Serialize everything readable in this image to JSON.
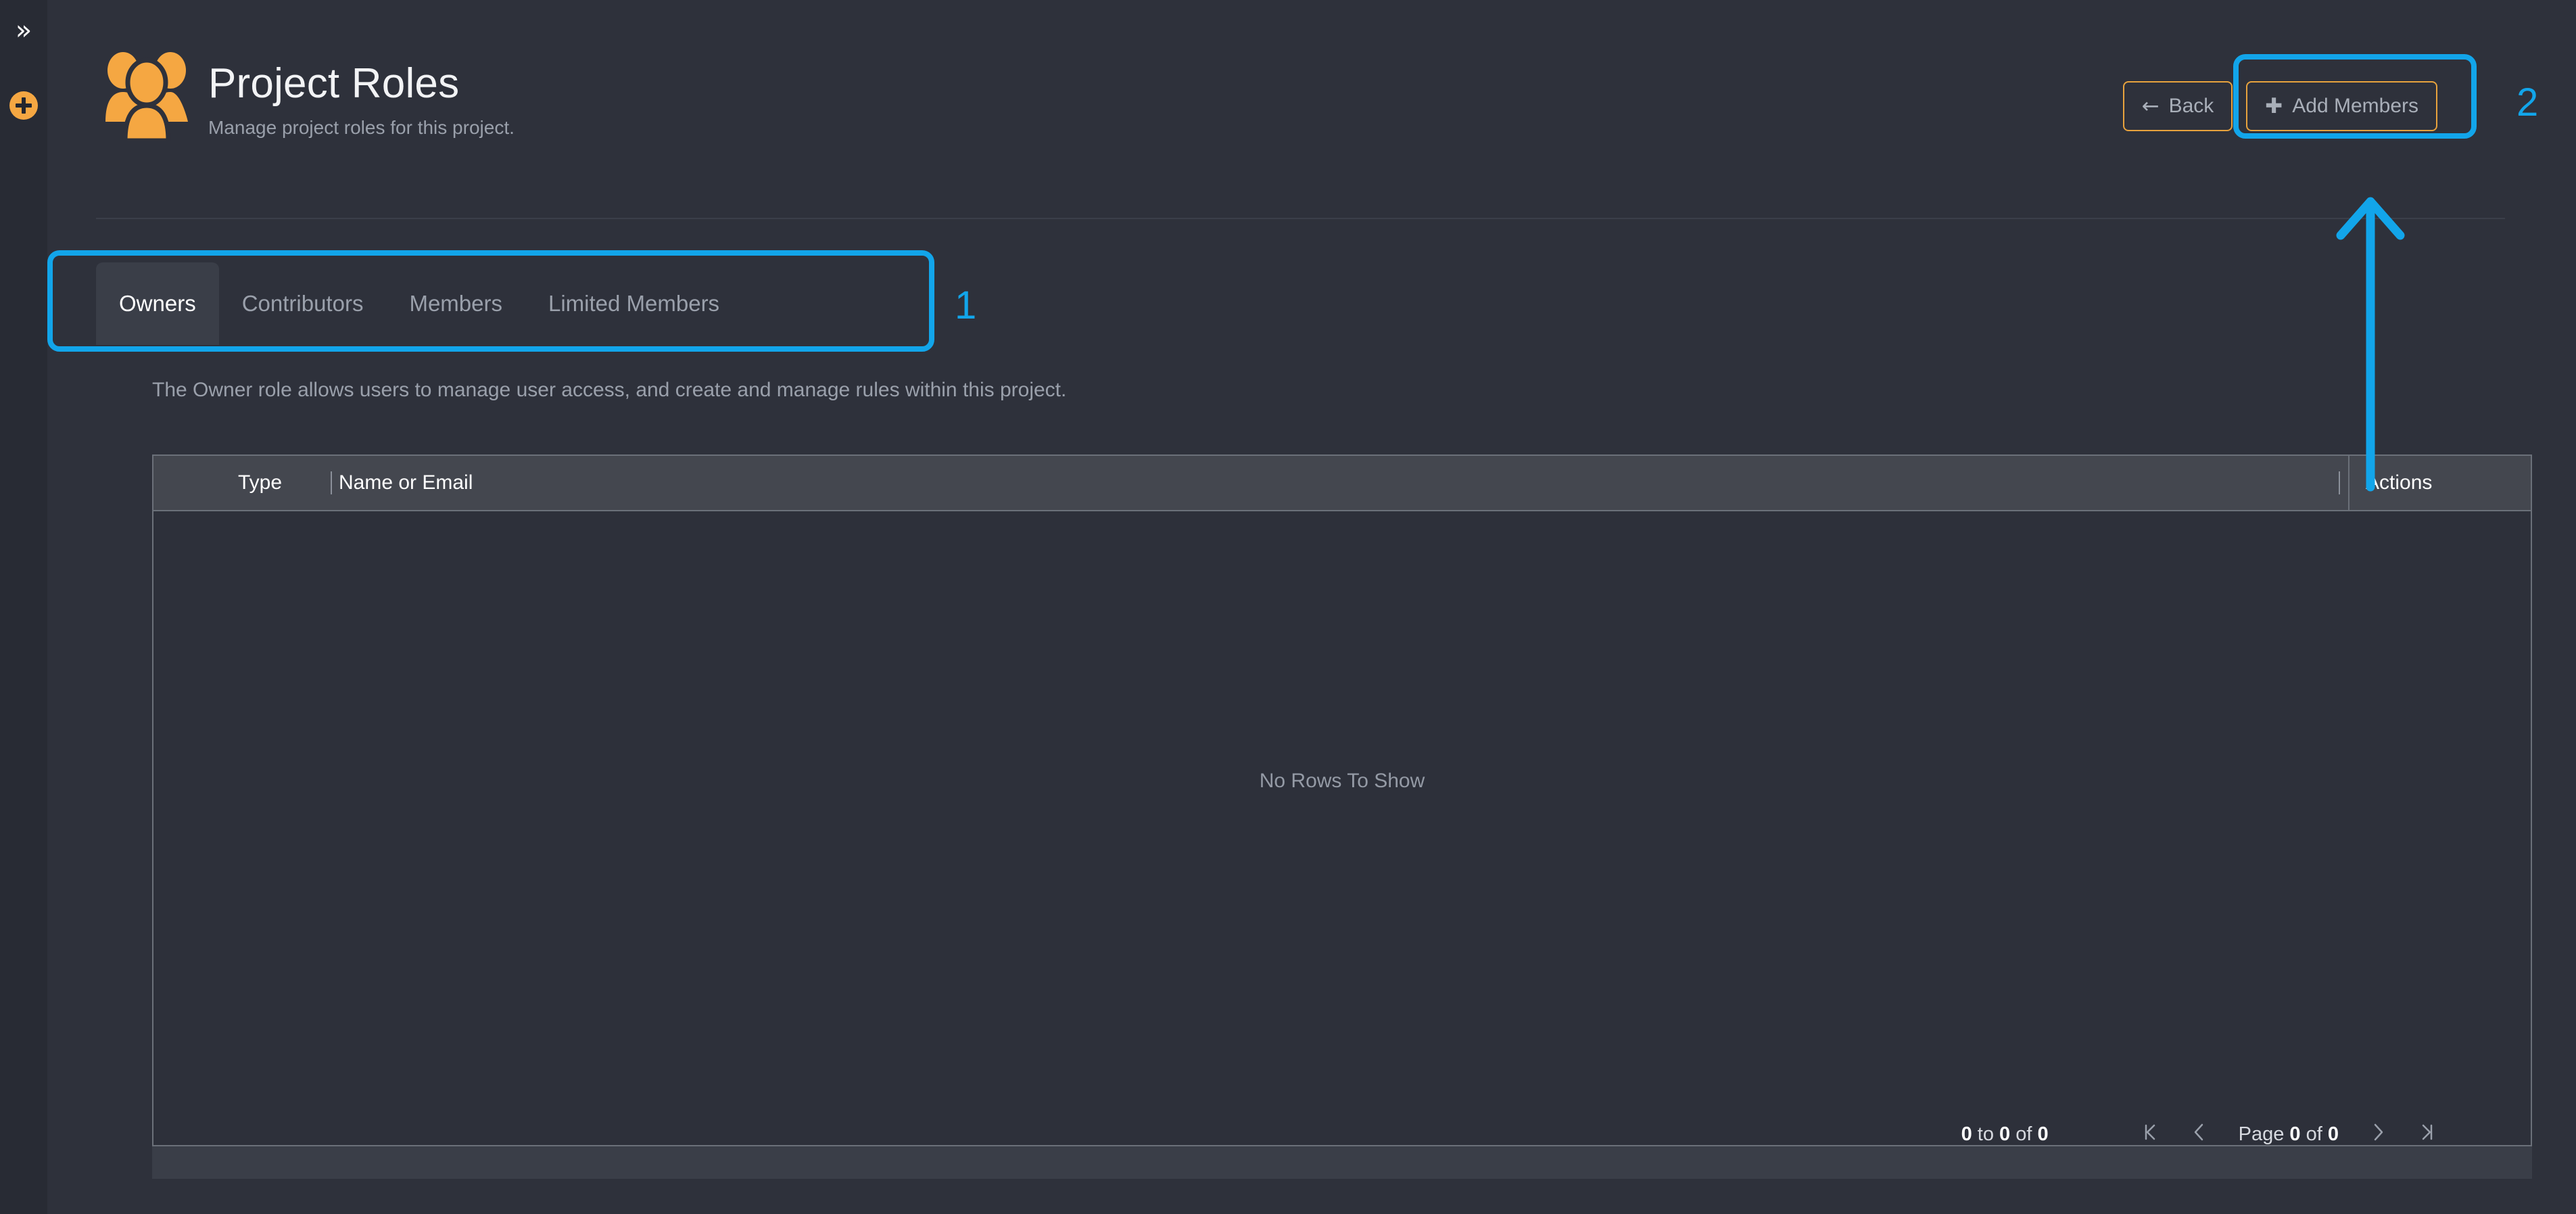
{
  "rail": {
    "expand_icon": "chevron-double-right-icon",
    "expand_glyph": "»",
    "add_icon": "plus-circle-icon"
  },
  "header": {
    "icon": "people-group-icon",
    "title": "Project Roles",
    "subtitle": "Manage project roles for this project.",
    "buttons": [
      {
        "id": "back",
        "label": "Back",
        "glyph": "←",
        "icon": "arrow-left-icon"
      },
      {
        "id": "add-members",
        "label": "Add Members",
        "glyph": "✚",
        "icon": "plus-icon"
      }
    ]
  },
  "tabs": {
    "active_index": 0,
    "items": [
      {
        "label": "Owners"
      },
      {
        "label": "Contributors"
      },
      {
        "label": "Members"
      },
      {
        "label": "Limited Members"
      }
    ]
  },
  "content": {
    "description": "The Owner role allows users to manage user access, and create and manage rules within this project."
  },
  "grid": {
    "columns": [
      "Type",
      "Name or Email",
      "Actions"
    ],
    "rows": [],
    "empty_text": "No Rows To Show"
  },
  "pagination": {
    "range_prefix": "0",
    "range_mid": "to",
    "range_second": "0",
    "range_of": "of",
    "range_total": "0",
    "first_glyph": "⧏|",
    "prev_glyph": "‹",
    "page_word": "Page",
    "page_current": "0",
    "page_of": "of",
    "page_total": "0",
    "next_glyph": "›",
    "last_glyph": "|⧐"
  },
  "annotations": {
    "accent_color": "#12a5ea",
    "markers": [
      {
        "id": "1",
        "label": "1",
        "target": "tabs"
      },
      {
        "id": "2",
        "label": "2",
        "target": "add-members-button"
      }
    ]
  },
  "colors": {
    "page_background": "#2e313b",
    "rail_background": "#282b34",
    "grid_header": "#44474f",
    "grid_body": "#2d303a",
    "accent_orange": "#f5a742",
    "annotation_blue": "#12a5ea"
  }
}
